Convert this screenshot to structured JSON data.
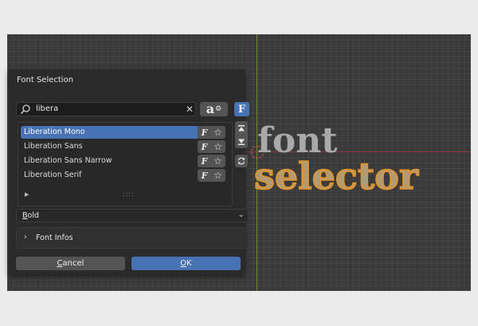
{
  "dialog": {
    "title": "Font Selection",
    "search": {
      "value": "libera"
    },
    "fonts": [
      {
        "label": "Liberation Mono",
        "selected": true
      },
      {
        "label": "Liberation Sans",
        "selected": false
      },
      {
        "label": "Liberation Sans Narrow",
        "selected": false
      },
      {
        "label": "Liberation Serif",
        "selected": false
      }
    ],
    "weight_dropdown": {
      "prefix": "B",
      "rest": "old"
    },
    "panel": {
      "label": "Font Infos"
    },
    "cancel_prefix": "C",
    "cancel_rest": "ancel",
    "ok_prefix": "O",
    "ok_rest": "K",
    "preview_glyph": "a",
    "font_glyph": "F",
    "row_font_glyph": "F"
  },
  "viewport": {
    "line1": "font",
    "line2": "selector"
  },
  "colors": {
    "accent": "#4772b3",
    "text_outline": "#e89426",
    "axis_y": "#6b8f2c",
    "axis_x": "#8a3a3a"
  }
}
